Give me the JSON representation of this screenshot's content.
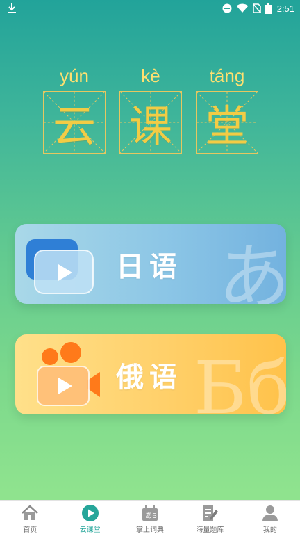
{
  "status_bar": {
    "time": "2:51"
  },
  "title": {
    "pinyin": [
      "yún",
      "kè",
      "táng"
    ],
    "characters": [
      "云",
      "课",
      "堂"
    ]
  },
  "cards": [
    {
      "label": "日语",
      "watermark": "あ",
      "icon": "video-play-icon"
    },
    {
      "label": "俄语",
      "watermark": "Бб",
      "icon": "video-camera-icon"
    }
  ],
  "bottom_nav": {
    "items": [
      {
        "label": "首页",
        "icon": "home-icon",
        "active": false
      },
      {
        "label": "云课堂",
        "icon": "play-circle-icon",
        "active": true
      },
      {
        "label": "掌上词典",
        "icon": "dictionary-icon",
        "active": false
      },
      {
        "label": "海量题库",
        "icon": "edit-document-icon",
        "active": false
      },
      {
        "label": "我的",
        "icon": "person-icon",
        "active": false
      }
    ]
  },
  "colors": {
    "accent": "#26a69a",
    "title_gold": "#f2cc45",
    "nav_inactive": "#6b6b6b"
  }
}
